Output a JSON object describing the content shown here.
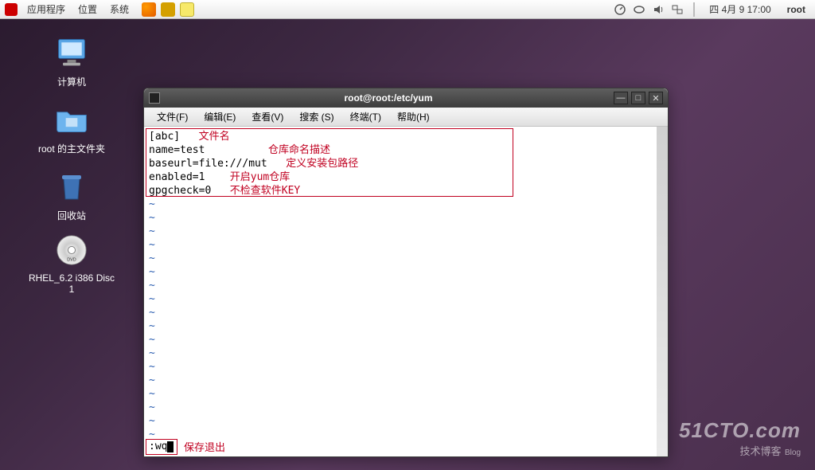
{
  "panel": {
    "menus": {
      "apps": "应用程序",
      "places": "位置",
      "system": "系统"
    },
    "date": "四 4月  9 17:00",
    "user": "root"
  },
  "desktop": {
    "computer": "计算机",
    "home": "root 的主文件夹",
    "trash": "回收站",
    "dvd": "RHEL_6.2 i386 Disc 1"
  },
  "terminal": {
    "title": "root@root:/etc/yum",
    "menus": {
      "file": "文件(F)",
      "edit": "编辑(E)",
      "view": "查看(V)",
      "search": "搜索 (S)",
      "terminal": "终端(T)",
      "help": "帮助(H)"
    },
    "content": {
      "l1": "[abc]",
      "a1": "文件名",
      "l2": "name=test",
      "l3": "baseurl=file:///mut",
      "a23": "仓库命名描述",
      "a3": "定义安装包路径",
      "l4": "enabled=1",
      "a4": "开启yum仓库",
      "l5": "gpgcheck=0",
      "a5": "不检查软件KEY",
      "wq": ":wq",
      "awq": "保存退出",
      "tilde": "~"
    }
  },
  "watermark": {
    "big": "51CTO.com",
    "small": "技术博客",
    "tag": "Blog"
  }
}
